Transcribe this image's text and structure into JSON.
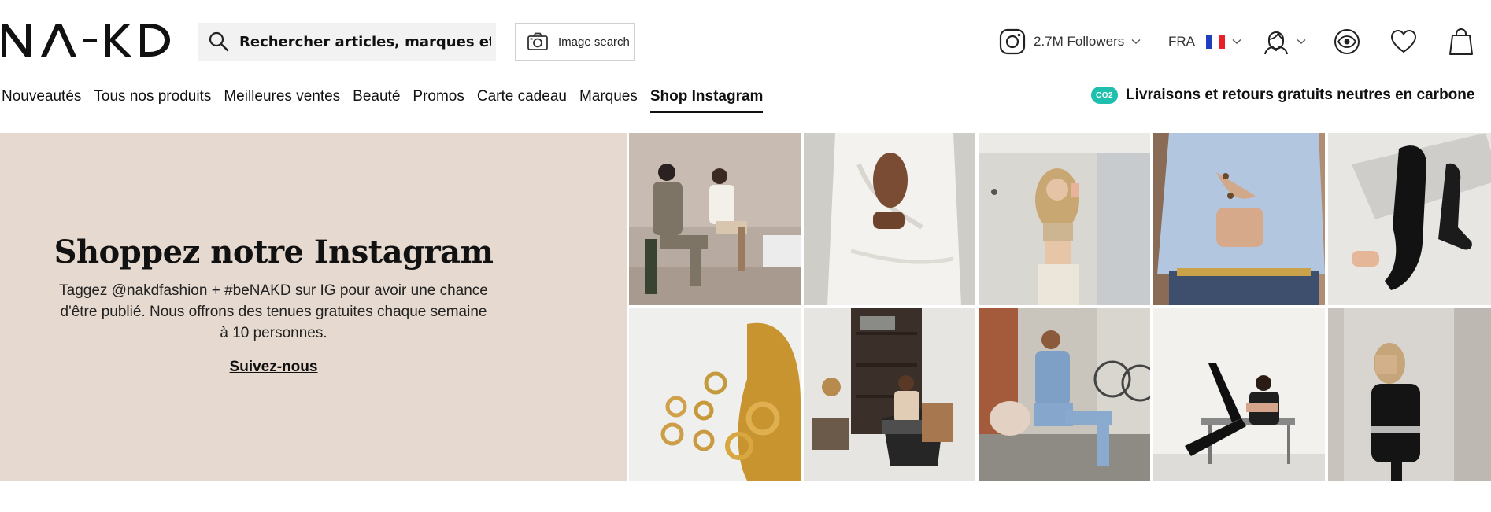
{
  "brand": {
    "logo_text": "NA-KD"
  },
  "search": {
    "placeholder": "Rechercher articles, marques et inspirations"
  },
  "image_search": {
    "label": "Image search"
  },
  "instagram": {
    "followers": "2.7M Followers"
  },
  "language": {
    "code": "FRA"
  },
  "nav": {
    "items": [
      {
        "label": "Nouveautés"
      },
      {
        "label": "Tous nos produits"
      },
      {
        "label": "Meilleures ventes"
      },
      {
        "label": "Beauté"
      },
      {
        "label": "Promos"
      },
      {
        "label": "Carte cadeau"
      },
      {
        "label": "Marques"
      },
      {
        "label": "Shop Instagram"
      }
    ],
    "active": "Shop Instagram"
  },
  "shipping": {
    "badge": "CO2",
    "text": "Livraisons et retours gratuits neutres en carbone"
  },
  "hero": {
    "title": "Shoppez notre Instagram",
    "body": "Taggez @nakdfashion + #beNAKD sur IG pour avoir une chance d'être publié. Nous offrons des tenues gratuites chaque semaine à 10 personnes.",
    "link": "Suivez-nous"
  },
  "colors": {
    "hero_bg": "#e6d9cf",
    "co2_badge": "#1fbfae",
    "text": "#111111"
  },
  "icons": {
    "search": "search-icon",
    "camera": "camera-icon",
    "instagram": "instagram-icon",
    "account": "account-icon",
    "eye": "eye-icon",
    "heart": "heart-icon",
    "bag": "shopping-bag-icon"
  }
}
